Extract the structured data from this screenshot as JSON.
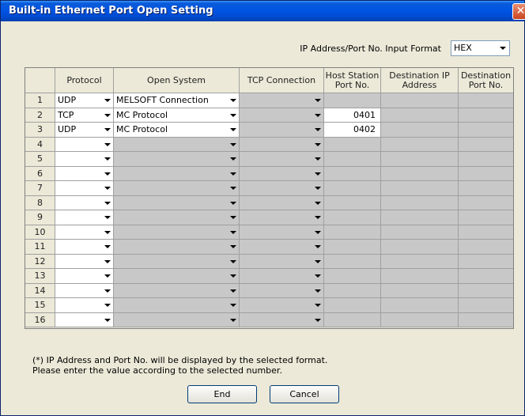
{
  "window": {
    "title": "Built-in Ethernet Port Open Setting"
  },
  "format": {
    "label": "IP Address/Port No. Input Format",
    "value": "HEX"
  },
  "table": {
    "headers": [
      "Protocol",
      "Open System",
      "TCP Connection",
      "Host Station Port No.",
      "Destination IP Address",
      "Destination Port No."
    ],
    "rows": [
      {
        "num": "1",
        "protocol": "UDP",
        "open_system": "MELSOFT Connection",
        "tcp": "",
        "host_port": "",
        "active": true,
        "host_enabled": false
      },
      {
        "num": "2",
        "protocol": "TCP",
        "open_system": "MC Protocol",
        "tcp": "",
        "host_port": "0401",
        "active": true,
        "host_enabled": true
      },
      {
        "num": "3",
        "protocol": "UDP",
        "open_system": "MC Protocol",
        "tcp": "",
        "host_port": "0402",
        "active": true,
        "host_enabled": true
      },
      {
        "num": "4",
        "protocol": "",
        "open_system": "",
        "tcp": "",
        "host_port": "",
        "active": false,
        "host_enabled": false
      },
      {
        "num": "5",
        "protocol": "",
        "open_system": "",
        "tcp": "",
        "host_port": "",
        "active": false,
        "host_enabled": false
      },
      {
        "num": "6",
        "protocol": "",
        "open_system": "",
        "tcp": "",
        "host_port": "",
        "active": false,
        "host_enabled": false
      },
      {
        "num": "7",
        "protocol": "",
        "open_system": "",
        "tcp": "",
        "host_port": "",
        "active": false,
        "host_enabled": false
      },
      {
        "num": "8",
        "protocol": "",
        "open_system": "",
        "tcp": "",
        "host_port": "",
        "active": false,
        "host_enabled": false
      },
      {
        "num": "9",
        "protocol": "",
        "open_system": "",
        "tcp": "",
        "host_port": "",
        "active": false,
        "host_enabled": false
      },
      {
        "num": "10",
        "protocol": "",
        "open_system": "",
        "tcp": "",
        "host_port": "",
        "active": false,
        "host_enabled": false
      },
      {
        "num": "11",
        "protocol": "",
        "open_system": "",
        "tcp": "",
        "host_port": "",
        "active": false,
        "host_enabled": false
      },
      {
        "num": "12",
        "protocol": "",
        "open_system": "",
        "tcp": "",
        "host_port": "",
        "active": false,
        "host_enabled": false
      },
      {
        "num": "13",
        "protocol": "",
        "open_system": "",
        "tcp": "",
        "host_port": "",
        "active": false,
        "host_enabled": false
      },
      {
        "num": "14",
        "protocol": "",
        "open_system": "",
        "tcp": "",
        "host_port": "",
        "active": false,
        "host_enabled": false
      },
      {
        "num": "15",
        "protocol": "",
        "open_system": "",
        "tcp": "",
        "host_port": "",
        "active": false,
        "host_enabled": false
      },
      {
        "num": "16",
        "protocol": "",
        "open_system": "",
        "tcp": "",
        "host_port": "",
        "active": false,
        "host_enabled": false
      }
    ]
  },
  "note": {
    "line1": "(*) IP Address and Port No. will be displayed by the selected format.",
    "line2": "Please enter the value according to the selected number."
  },
  "buttons": {
    "end": "End",
    "cancel": "Cancel"
  },
  "colors": {
    "title_bar": "#0054e3",
    "disabled_cell": "#c8c8c8",
    "window_bg": "#ece9d8"
  }
}
